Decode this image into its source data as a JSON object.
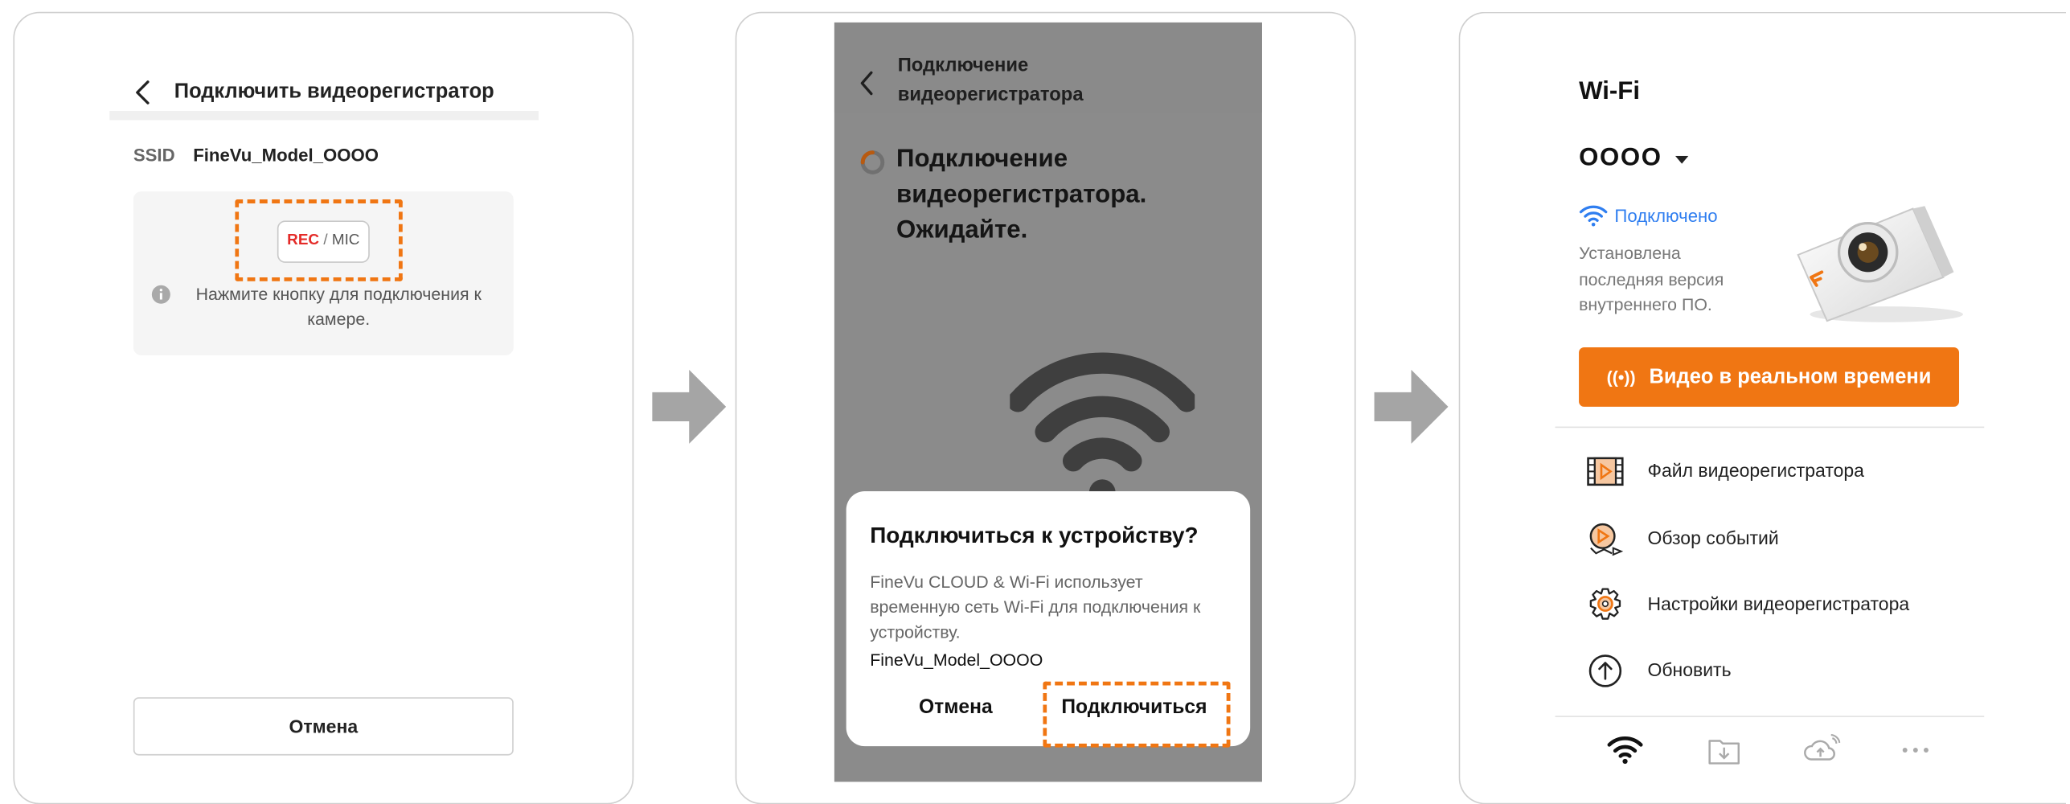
{
  "step1": {
    "title": "Подключить видеорегистратор",
    "ssid_key": "SSID",
    "ssid_value": "FineVu_Model_OOOO",
    "rec_label": "REC",
    "slash": "/",
    "mic_label": "MIC",
    "hint": "Нажмите кнопку для подключения к камере.",
    "cancel_label": "Отмена"
  },
  "step2": {
    "header_title": "Подключение видеорегистратора",
    "waiting_text": "Подключение видеорегистратора. Ожидайте.",
    "dialog": {
      "title": "Подключиться к устройству?",
      "text": "FineVu CLOUD & Wi-Fi использует временную сеть Wi-Fi для подключения к устройству.",
      "ssid": "FineVu_Model_OOOO",
      "cancel_label": "Отмена",
      "connect_label": "Подключиться"
    }
  },
  "step3": {
    "title": "Wi-Fi",
    "model": "OOOO",
    "status": "Подключено",
    "firmware_text": "Установлена последняя версия внутреннего ПО.",
    "live_label": "Видео в реальном времени",
    "live_icon": "((•))",
    "menu": [
      {
        "label": "Файл видеорегистратора",
        "icon": "film-icon"
      },
      {
        "label": "Обзор событий",
        "icon": "event-play-icon"
      },
      {
        "label": "Настройки видеорегистратора",
        "icon": "gear-icon"
      },
      {
        "label": "Обновить",
        "icon": "upload-arrow-icon"
      }
    ],
    "tabs": [
      "wifi-icon",
      "download-folder-icon",
      "cloud-icon",
      "more-icon"
    ]
  },
  "colors": {
    "accent": "#f07613",
    "link_blue": "#2f7ef0",
    "rec_red": "#e42b28",
    "overlay_gray": "#8b8b8b"
  }
}
